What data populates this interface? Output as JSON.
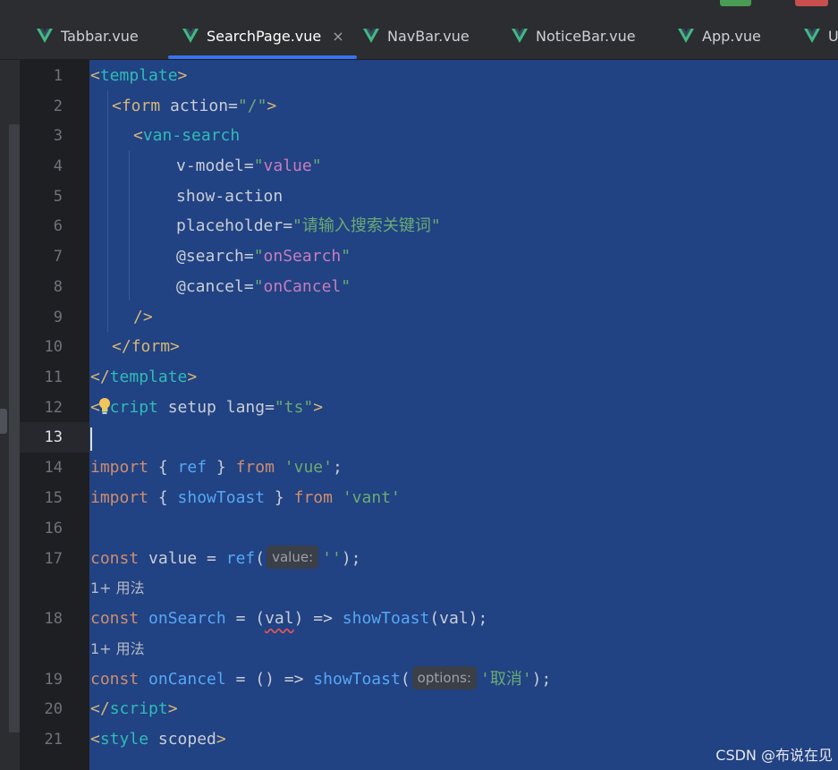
{
  "tabs": [
    {
      "label": "Tabbar.vue",
      "active": false
    },
    {
      "label": "SearchPage.vue",
      "active": true,
      "close": "×"
    },
    {
      "label": "NavBar.vue",
      "active": false
    },
    {
      "label": "NoticeBar.vue",
      "active": false
    },
    {
      "label": "App.vue",
      "active": false
    },
    {
      "label": "U",
      "active": false
    }
  ],
  "line_numbers": [
    "1",
    "2",
    "3",
    "4",
    "5",
    "6",
    "7",
    "8",
    "9",
    "10",
    "11",
    "12",
    "13",
    "14",
    "15",
    "16",
    "17",
    "18",
    "19",
    "20",
    "21"
  ],
  "current_line": "13",
  "code": {
    "l1": {
      "open": "<",
      "name": "template",
      "close": ">"
    },
    "l2": {
      "open": "<",
      "name": "form",
      "attr": " action=",
      "val": "\"/\"",
      "close": ">"
    },
    "l3": {
      "open": "<",
      "name": "van-search"
    },
    "l4": {
      "attr": "v-model=",
      "q1": "\"",
      "val": "value",
      "q2": "\""
    },
    "l5": {
      "attr": "show-action"
    },
    "l6": {
      "attr": "placeholder=",
      "val": "\"请输入搜索关键词\""
    },
    "l7": {
      "attr": "@search=",
      "q1": "\"",
      "val": "onSearch",
      "q2": "\""
    },
    "l8": {
      "attr": "@cancel=",
      "q1": "\"",
      "val": "onCancel",
      "q2": "\""
    },
    "l9": {
      "close": "/>"
    },
    "l10": {
      "open": "</",
      "name": "form",
      "close": ">"
    },
    "l11": {
      "open": "</",
      "name": "template",
      "close": ">"
    },
    "l12": {
      "open": "<",
      "name": "script",
      "attr": " setup lang=",
      "val": "\"ts\"",
      "close": ">"
    },
    "l14": {
      "kw1": "import",
      "p1": " { ",
      "id": "ref",
      "p2": " } ",
      "kw2": "from",
      "sp": " ",
      "str": "'vue'",
      "end": ";"
    },
    "l15": {
      "kw1": "import",
      "p1": " { ",
      "id": "showToast",
      "p2": " } ",
      "kw2": "from",
      "sp": " ",
      "str": "'vant'"
    },
    "l17": {
      "kw": "const",
      "p1": " value = ",
      "fn": "ref",
      "p2": "(",
      "hint": "value:",
      "str": "''",
      "end": ");"
    },
    "usage1": "1+ 用法",
    "l18": {
      "kw": "const",
      "sp": " ",
      "fn1": "onSearch",
      "p1": " = (",
      "arg": "val",
      "p2": ") => ",
      "fn2": "showToast",
      "end": "(val);"
    },
    "usage2": "1+ 用法",
    "l19": {
      "kw": "const",
      "sp": " ",
      "fn1": "onCancel",
      "p1": " = () => ",
      "fn2": "showToast",
      "p2": "(",
      "hint": "options:",
      "str": "'取消'",
      "end": ");"
    },
    "l20": {
      "open": "</",
      "name": "script",
      "close": ">"
    },
    "l21": {
      "open": "<",
      "name": "style",
      "attr": " scoped",
      "close": ">"
    }
  },
  "watermark": "CSDN @布说在见",
  "colors": {
    "selection": "#214283",
    "tab_underline": "#3574f0",
    "vue_logo": "#41b883"
  }
}
